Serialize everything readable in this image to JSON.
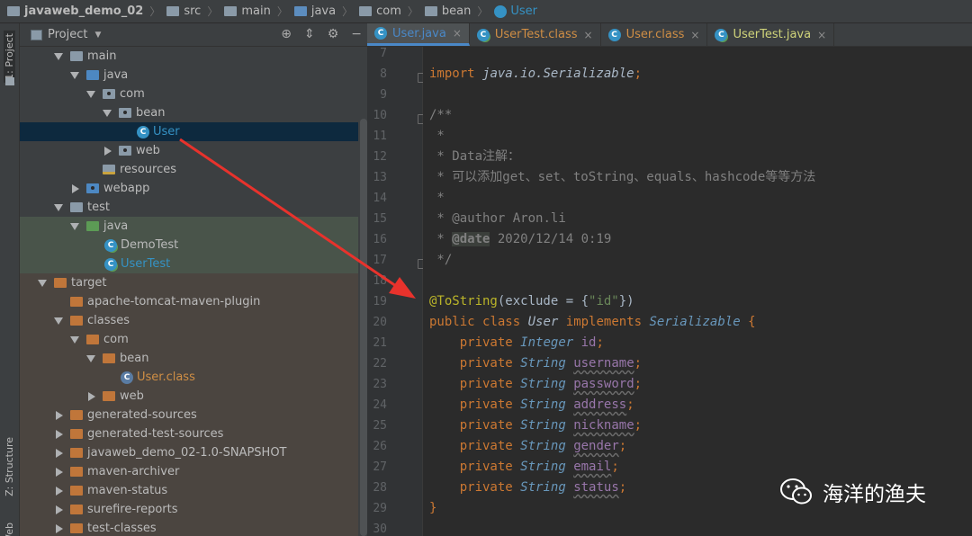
{
  "breadcrumb": {
    "items": [
      "javaweb_demo_02",
      "src",
      "main",
      "java",
      "com",
      "bean",
      "User"
    ]
  },
  "left_strip": {
    "project_label": "1: Project",
    "structure_label": "Z: Structure",
    "web_label": "Web"
  },
  "project_panel": {
    "title": "Project",
    "dropdown_icon": "caret-down-icon",
    "header_icons": [
      "crosshair-icon",
      "collapse-icon",
      "gear-icon",
      "minimize-icon"
    ]
  },
  "tree": [
    {
      "label": "main",
      "expanded": true,
      "icon": "folder"
    },
    {
      "label": "java",
      "expanded": true,
      "icon": "source-folder"
    },
    {
      "label": "com",
      "expanded": true,
      "icon": "package"
    },
    {
      "label": "bean",
      "expanded": true,
      "icon": "package"
    },
    {
      "label": "User",
      "icon": "class",
      "selected": true
    },
    {
      "label": "web",
      "expanded": false,
      "icon": "package"
    },
    {
      "label": "resources",
      "icon": "resources-folder"
    },
    {
      "label": "webapp",
      "expanded": false,
      "icon": "web-folder"
    },
    {
      "label": "test",
      "expanded": true,
      "icon": "folder"
    },
    {
      "label": "java",
      "expanded": true,
      "icon": "test-source-folder"
    },
    {
      "label": "DemoTest",
      "icon": "test-class"
    },
    {
      "label": "UserTest",
      "icon": "test-class"
    },
    {
      "label": "target",
      "expanded": true,
      "icon": "excluded-folder"
    },
    {
      "label": "apache-tomcat-maven-plugin",
      "icon": "excluded-folder"
    },
    {
      "label": "classes",
      "expanded": true,
      "icon": "excluded-folder"
    },
    {
      "label": "com",
      "expanded": true,
      "icon": "excluded-folder"
    },
    {
      "label": "bean",
      "expanded": true,
      "icon": "excluded-folder"
    },
    {
      "label": "User.class",
      "icon": "class-file"
    },
    {
      "label": "web",
      "expanded": false,
      "icon": "excluded-folder"
    },
    {
      "label": "generated-sources",
      "expanded": false,
      "icon": "excluded-folder"
    },
    {
      "label": "generated-test-sources",
      "expanded": false,
      "icon": "excluded-folder"
    },
    {
      "label": "javaweb_demo_02-1.0-SNAPSHOT",
      "expanded": false,
      "icon": "excluded-folder"
    },
    {
      "label": "maven-archiver",
      "expanded": false,
      "icon": "excluded-folder"
    },
    {
      "label": "maven-status",
      "expanded": false,
      "icon": "excluded-folder"
    },
    {
      "label": "surefire-reports",
      "expanded": false,
      "icon": "excluded-folder"
    },
    {
      "label": "test-classes",
      "expanded": false,
      "icon": "excluded-folder"
    }
  ],
  "tabs": [
    {
      "label": "User.java",
      "active": true
    },
    {
      "label": "UserTest.class",
      "active": false
    },
    {
      "label": "User.class",
      "active": false
    },
    {
      "label": "UserTest.java",
      "active": false
    }
  ],
  "tab_close": "×",
  "editor": {
    "line_numbers": [
      "7",
      "8",
      "9",
      "10",
      "11",
      "12",
      "13",
      "14",
      "15",
      "16",
      "17",
      "18",
      "19",
      "20",
      "21",
      "22",
      "23",
      "24",
      "25",
      "26",
      "27",
      "28",
      "29",
      "30"
    ],
    "import_kw": "import",
    "import_path": "java.io.Serializable",
    "semicolon": ";",
    "doc_open": "/**",
    "doc_star": " *",
    "doc_data": " * Data注解：",
    "doc_methods": " * 可以添加get、set、toString、equals、hashcode等等方法",
    "doc_author_tag": "@author",
    "doc_author": " Aron.li",
    "doc_date_tag": "@date",
    "doc_date": " 2020/12/14 0:19",
    "doc_close": " */",
    "annotation": "@ToString",
    "ann_open": "(exclude = {",
    "ann_string": "\"id\"",
    "ann_close": "})",
    "kw_public": "public",
    "kw_class": "class",
    "class_name": "User",
    "kw_implements": "implements",
    "iface": "Serializable",
    "brace_open": "{",
    "brace_close": "}",
    "kw_private": "private",
    "fields": [
      {
        "type": "Integer",
        "name": "id",
        "warn": false
      },
      {
        "type": "String",
        "name": "username",
        "warn": true
      },
      {
        "type": "String",
        "name": "password",
        "warn": true
      },
      {
        "type": "String",
        "name": "address",
        "warn": true
      },
      {
        "type": "String",
        "name": "nickname",
        "warn": true
      },
      {
        "type": "String",
        "name": "gender",
        "warn": true
      },
      {
        "type": "String",
        "name": "email",
        "warn": true
      },
      {
        "type": "String",
        "name": "status",
        "warn": true
      }
    ]
  },
  "watermark": {
    "text": "海洋的渔夫",
    "icon": "wechat-icon"
  },
  "colors": {
    "keyword": "#cc7832",
    "annotation": "#bbb529",
    "string": "#6a8759",
    "field": "#9876aa",
    "comment": "#808080",
    "arrow": "#e8322c",
    "selection": "#0d293e"
  }
}
